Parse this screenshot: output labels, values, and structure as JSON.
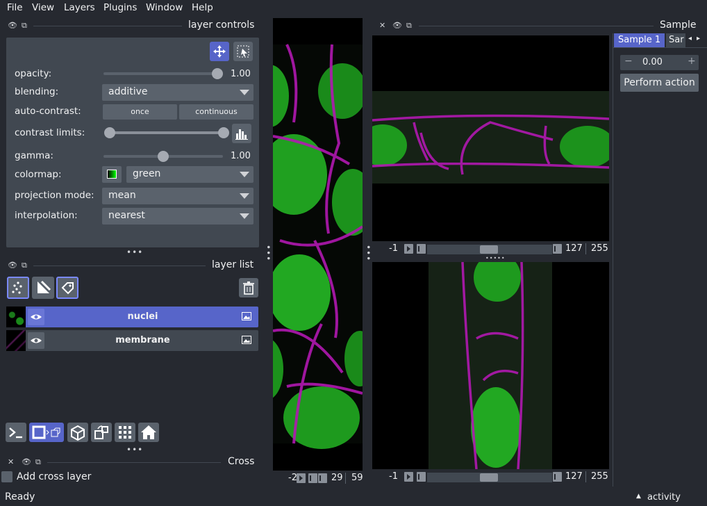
{
  "menu": [
    "File",
    "View",
    "Layers",
    "Plugins",
    "Window",
    "Help"
  ],
  "docks": {
    "layer_controls_title": "layer controls",
    "layer_list_title": "layer list",
    "cross_title": "Cross",
    "sample_title": "Sample"
  },
  "controls": {
    "opacity_label": "opacity:",
    "opacity_value": "1.00",
    "opacity_level": 1.0,
    "blending_label": "blending:",
    "blending_value": "additive",
    "auto_contrast_label": "auto-contrast:",
    "once_label": "once",
    "continuous_label": "continuous",
    "contrast_limits_label": "contrast limits:",
    "gamma_label": "gamma:",
    "gamma_value": "1.00",
    "gamma_level": 0.5,
    "colormap_label": "colormap:",
    "colormap_value": "green",
    "projection_label": "projection mode:",
    "projection_value": "mean",
    "interpolation_label": "interpolation:",
    "interpolation_value": "nearest"
  },
  "layers": [
    {
      "name": "nuclei",
      "selected": true
    },
    {
      "name": "membrane",
      "selected": false
    }
  ],
  "cross": {
    "checkbox_label": "Add cross layer"
  },
  "sample": {
    "tab1": "Sample 1",
    "tab2": "Sar",
    "spin_value": "0.00",
    "action_label": "Perform action"
  },
  "viewer": {
    "top_right_dims": {
      "start": "-1",
      "current": "127",
      "end": "255"
    },
    "bottom_right_dims": {
      "start": "-1",
      "current": "127",
      "end": "255"
    },
    "left_dims": {
      "start": "-2",
      "current": "29",
      "end": "59"
    }
  },
  "status": {
    "text": "Ready",
    "activity": "activity"
  },
  "colors": {
    "accent": "#5765c9",
    "panel": "#414851",
    "background": "#262930",
    "membrane": "#c020c0",
    "nuclei": "#20b020"
  }
}
